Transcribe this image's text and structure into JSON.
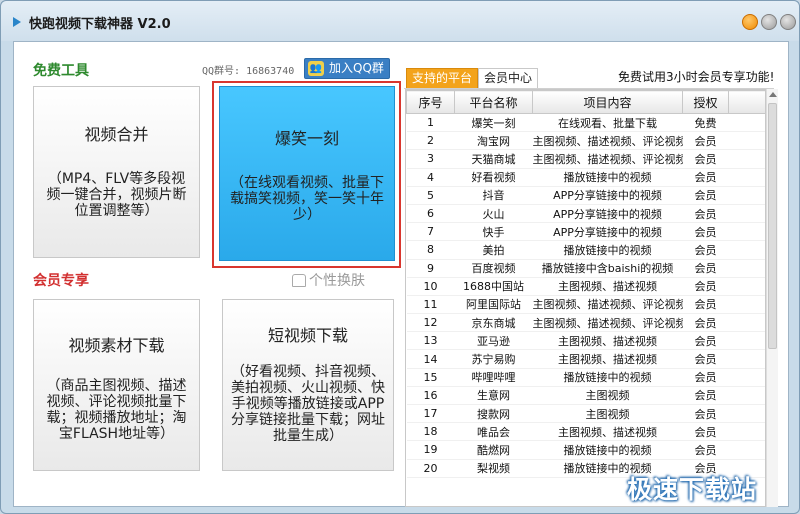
{
  "window": {
    "title": "快跑视频下载神器 V2.0"
  },
  "left": {
    "free_title": "免费工具",
    "qq_group": "QQ群号: 16863740",
    "qq_button": "加入QQ群",
    "vip_title": "会员专享",
    "skin_label": "个性换肤",
    "cards": {
      "merge": {
        "title": "视频合并",
        "desc": "（MP4、FLV等多段视频一键合并，视频片断位置调整等）"
      },
      "hot": {
        "title": "爆笑一刻",
        "desc": "（在线观看视频、批量下载搞笑视频，笑一笑十年少）"
      },
      "material": {
        "title": "视频素材下载",
        "desc": "（商品主图视频、描述视频、评论视频批量下载；视频播放地址；淘宝FLASH地址等）"
      },
      "short": {
        "title": "短视频下载",
        "desc": "（好看视频、抖音视频、美拍视频、火山视频、快手视频等播放链接或APP分享链接批量下载；网址批量生成）"
      }
    }
  },
  "right": {
    "tabs": [
      "支持的平台",
      "会员中心"
    ],
    "trial": "免费试用3小时会员专享功能!",
    "columns": [
      "序号",
      "平台名称",
      "项目内容",
      "授权"
    ],
    "rows": [
      [
        "1",
        "爆笑一刻",
        "在线观看、批量下载",
        "免费"
      ],
      [
        "2",
        "淘宝网",
        "主图视频、描述视频、评论视频",
        "会员"
      ],
      [
        "3",
        "天猫商城",
        "主图视频、描述视频、评论视频",
        "会员"
      ],
      [
        "4",
        "好看视频",
        "播放链接中的视频",
        "会员"
      ],
      [
        "5",
        "抖音",
        "APP分享链接中的视频",
        "会员"
      ],
      [
        "6",
        "火山",
        "APP分享链接中的视频",
        "会员"
      ],
      [
        "7",
        "快手",
        "APP分享链接中的视频",
        "会员"
      ],
      [
        "8",
        "美拍",
        "播放链接中的视频",
        "会员"
      ],
      [
        "9",
        "百度视频",
        "播放链接中含baishi的视频",
        "会员"
      ],
      [
        "10",
        "1688中国站",
        "主图视频、描述视频",
        "会员"
      ],
      [
        "11",
        "阿里国际站",
        "主图视频、描述视频、评论视频",
        "会员"
      ],
      [
        "12",
        "京东商城",
        "主图视频、描述视频、评论视频",
        "会员"
      ],
      [
        "13",
        "亚马逊",
        "主图视频、描述视频",
        "会员"
      ],
      [
        "14",
        "苏宁易购",
        "主图视频、描述视频",
        "会员"
      ],
      [
        "15",
        "哔哩哔哩",
        "播放链接中的视频",
        "会员"
      ],
      [
        "16",
        "生意网",
        "主图视频",
        "会员"
      ],
      [
        "17",
        "搜款网",
        "主图视频",
        "会员"
      ],
      [
        "18",
        "唯品会",
        "主图视频、描述视频",
        "会员"
      ],
      [
        "19",
        "酷燃网",
        "播放链接中的视频",
        "会员"
      ],
      [
        "20",
        "梨视频",
        "播放链接中的视频",
        "会员"
      ]
    ]
  },
  "watermark": "极速下载站"
}
